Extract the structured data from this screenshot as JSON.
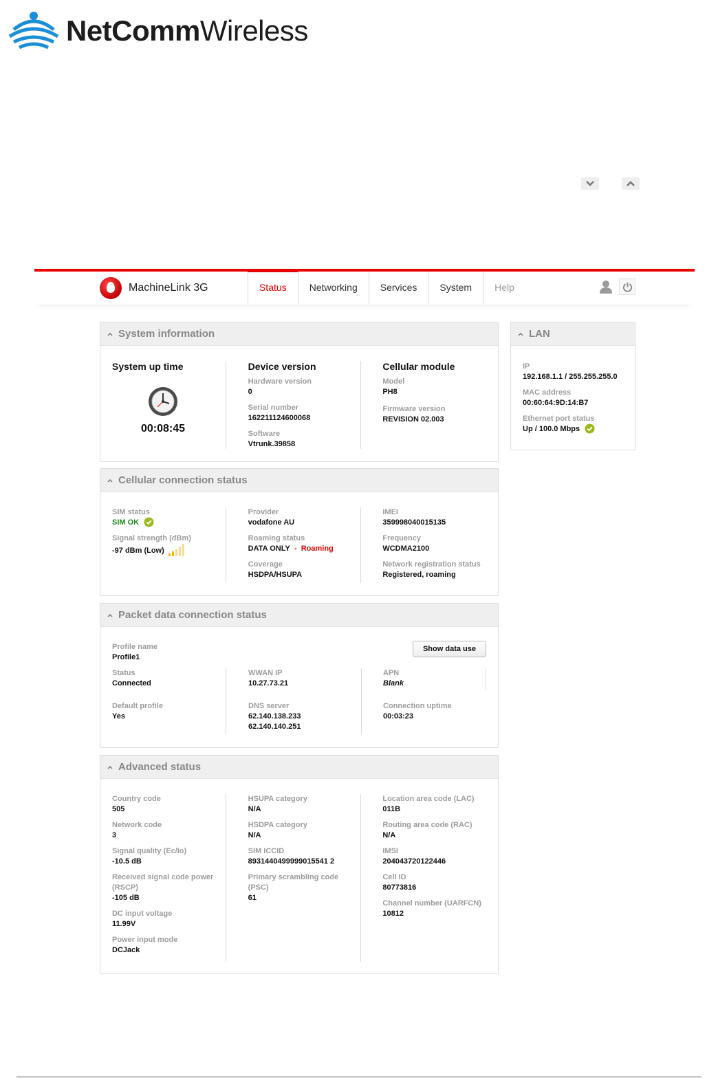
{
  "doc_logo": {
    "brand_bold": "NetComm",
    "brand_light": "Wireless"
  },
  "app": {
    "product_name": "MachineLink 3G",
    "nav": [
      {
        "label": "Status"
      },
      {
        "label": "Networking"
      },
      {
        "label": "Services"
      },
      {
        "label": "System"
      },
      {
        "label": "Help"
      }
    ]
  },
  "system_info": {
    "title": "System information",
    "uptime": {
      "heading": "System up time",
      "value": "00:08:45"
    },
    "device_version": {
      "heading": "Device version",
      "hardware_label": "Hardware version",
      "hardware_value": "0",
      "serial_label": "Serial number",
      "serial_value": "162211124600068",
      "software_label": "Software",
      "software_value": "Vtrunk.39858"
    },
    "cellular_module": {
      "heading": "Cellular module",
      "model_label": "Model",
      "model_value": "PH8",
      "firmware_label": "Firmware version",
      "firmware_value": "REVISION 02.003"
    }
  },
  "lan": {
    "title": "LAN",
    "ip_label": "IP",
    "ip_value": "192.168.1.1 / 255.255.255.0",
    "mac_label": "MAC address",
    "mac_value": "00:60:64:9D:14:B7",
    "eth_label": "Ethernet port status",
    "eth_value": "Up / 100.0 Mbps"
  },
  "cellular": {
    "title": "Cellular connection status",
    "sim_label": "SIM status",
    "sim_value": "SIM OK",
    "signal_label": "Signal strength (dBm)",
    "signal_value": "-97 dBm (Low)",
    "provider_label": "Provider",
    "provider_value": "vodafone AU",
    "roaming_label": "Roaming status",
    "roaming_value": "DATA ONLY",
    "roaming_sep": "-",
    "roaming_flag": "Roaming",
    "coverage_label": "Coverage",
    "coverage_value": "HSDPA/HSUPA",
    "imei_label": "IMEI",
    "imei_value": "359998040015135",
    "freq_label": "Frequency",
    "freq_value": "WCDMA2100",
    "netreg_label": "Network registration status",
    "netreg_value": "Registered, roaming"
  },
  "packet": {
    "title": "Packet data connection status",
    "profile_label": "Profile name",
    "profile_value": "Profile1",
    "show_data_use": "Show data use",
    "status_label": "Status",
    "status_value": "Connected",
    "default_label": "Default profile",
    "default_value": "Yes",
    "wwan_label": "WWAN IP",
    "wwan_value": "10.27.73.21",
    "dns_label": "DNS server",
    "dns_value_1": "62.140.138.233",
    "dns_value_2": "62.140.140.251",
    "apn_label": "APN",
    "apn_value": "Blank",
    "uptime_label": "Connection uptime",
    "uptime_value": "00:03:23"
  },
  "advanced": {
    "title": "Advanced status",
    "col1": [
      {
        "label": "Country code",
        "value": "505"
      },
      {
        "label": "Network code",
        "value": "3"
      },
      {
        "label": "Signal quality (Ec/Io)",
        "value": "-10.5 dB"
      },
      {
        "label": "Received signal code power (RSCP)",
        "value": "-105 dB"
      },
      {
        "label": "DC input voltage",
        "value": "11.99V"
      },
      {
        "label": "Power input mode",
        "value": "DCJack"
      }
    ],
    "col2": [
      {
        "label": "HSUPA category",
        "value": "N/A"
      },
      {
        "label": "HSDPA category",
        "value": "N/A"
      },
      {
        "label": "SIM ICCID",
        "value": "8931440499999015541 2"
      },
      {
        "label": "Primary scrambling code (PSC)",
        "value": "61"
      }
    ],
    "col3": [
      {
        "label": "Location area code (LAC)",
        "value": "011B"
      },
      {
        "label": "Routing area code (RAC)",
        "value": "N/A"
      },
      {
        "label": "IMSI",
        "value": "204043720122446"
      },
      {
        "label": "Cell ID",
        "value": "80773816"
      },
      {
        "label": "Channel number (UARFCN)",
        "value": "10812"
      }
    ]
  }
}
